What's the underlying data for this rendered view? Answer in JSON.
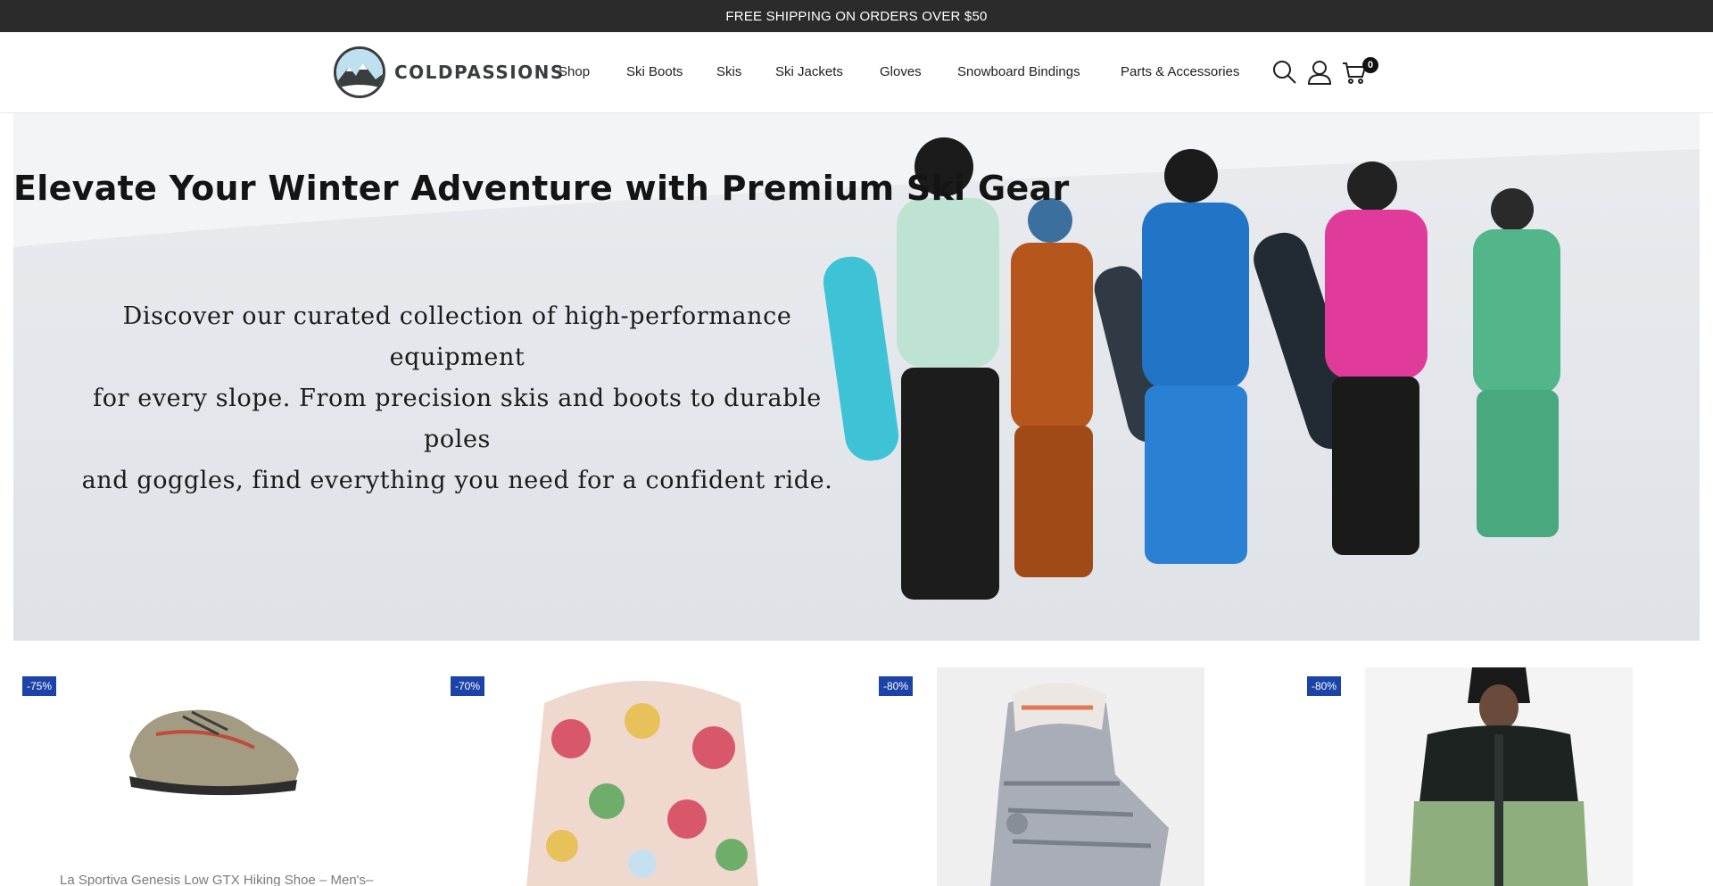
{
  "announcement": {
    "text": "FREE SHIPPING ON ORDERS OVER $50"
  },
  "brand": {
    "name": "COLDPASSIONS"
  },
  "nav": {
    "items": [
      {
        "label": "Shop"
      },
      {
        "label": "Ski Boots"
      },
      {
        "label": "Skis"
      },
      {
        "label": "Ski Jackets"
      },
      {
        "label": "Gloves"
      },
      {
        "label": "Snowboard Bindings"
      },
      {
        "label": "Parts & Accessories"
      }
    ]
  },
  "header_icons": {
    "search": "search-icon",
    "account": "user-icon",
    "cart": "cart-icon",
    "cart_count": "0"
  },
  "hero": {
    "title": "Elevate Your Winter Adventure with Premium Ski Gear",
    "subtitle_lines": [
      "Discover our curated collection of high-performance equipment",
      "for every slope. From precision skis and boots to durable poles",
      "and goggles, find everything you need for a confident ride."
    ]
  },
  "products": [
    {
      "badge": "-75%",
      "title": "La Sportiva Genesis Low GTX Hiking Shoe – Men's–",
      "image": "hiking-shoe"
    },
    {
      "badge": "-70%",
      "title": "",
      "image": "floral-bucket-hat"
    },
    {
      "badge": "-80%",
      "title": "",
      "image": "ski-boot"
    },
    {
      "badge": "-80%",
      "title": "",
      "image": "ski-jacket"
    }
  ],
  "colors": {
    "announcement_bg": "#2b2b2b",
    "badge_bg": "#1c43a8",
    "text": "#1f1f1f"
  }
}
